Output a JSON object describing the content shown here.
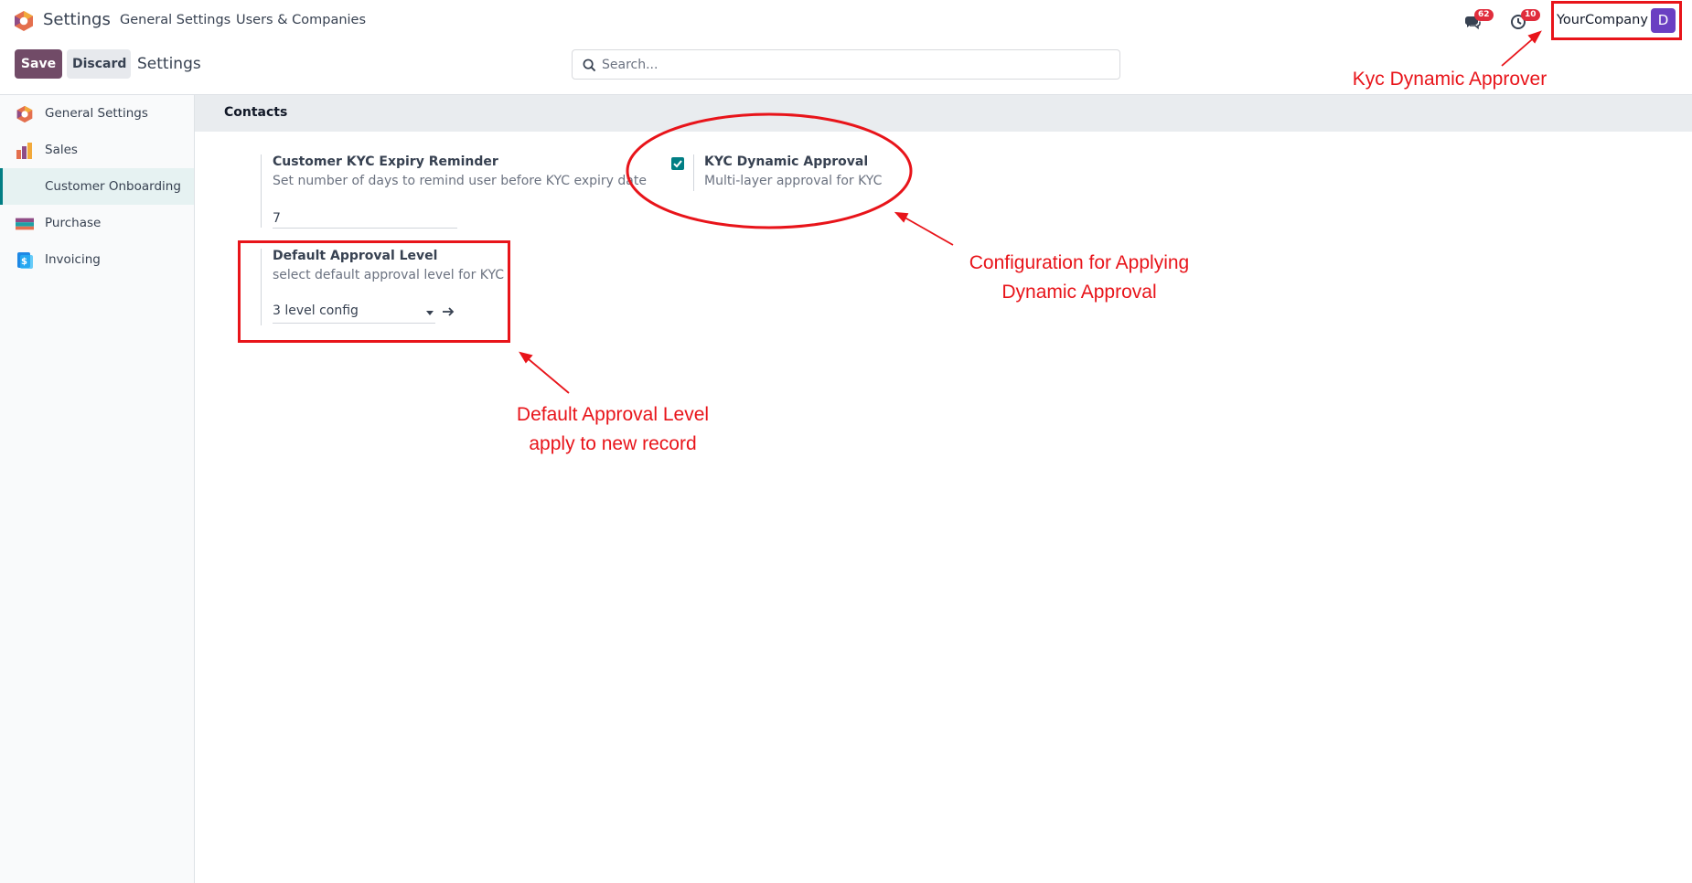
{
  "navbar": {
    "app_title": "Settings",
    "menus": [
      "General Settings",
      "Users & Companies"
    ],
    "messages_count": "62",
    "activities_count": "10",
    "company": "YourCompany",
    "avatar_letter": "D"
  },
  "control_panel": {
    "save_label": "Save",
    "discard_label": "Discard",
    "title": "Settings",
    "search_placeholder": "Search..."
  },
  "sidebar": {
    "items": [
      {
        "label": "General Settings",
        "icon": "odoo-logo-icon"
      },
      {
        "label": "Sales",
        "icon": "sales-chart-icon"
      },
      {
        "label": "Customer Onboarding",
        "icon": "",
        "active": true
      },
      {
        "label": "Purchase",
        "icon": "purchase-card-icon"
      },
      {
        "label": "Invoicing",
        "icon": "invoicing-icon"
      }
    ]
  },
  "section": {
    "title": "Contacts",
    "kyc_reminder": {
      "title": "Customer KYC Expiry Reminder",
      "description": "Set number of days to remind user before KYC expiry date",
      "value": "7"
    },
    "dynamic_approval": {
      "title": "KYC Dynamic Approval",
      "description": "Multi-layer approval for KYC",
      "checked": true
    },
    "default_level": {
      "title": "Default Approval Level",
      "description": "select default approval level for KYC",
      "value": "3 level config"
    }
  },
  "annotations": {
    "approver": "Kyc Dynamic Approver",
    "config_line1": "Configuration for Applying",
    "config_line2": "Dynamic Approval",
    "default_line1": "Default Approval Level",
    "default_line2": "apply to new record",
    "color": "#e8141a"
  },
  "colors": {
    "primary": "#714b67",
    "accent": "#017e84",
    "badge": "#e02d3c",
    "avatar": "#6a3fc2"
  }
}
